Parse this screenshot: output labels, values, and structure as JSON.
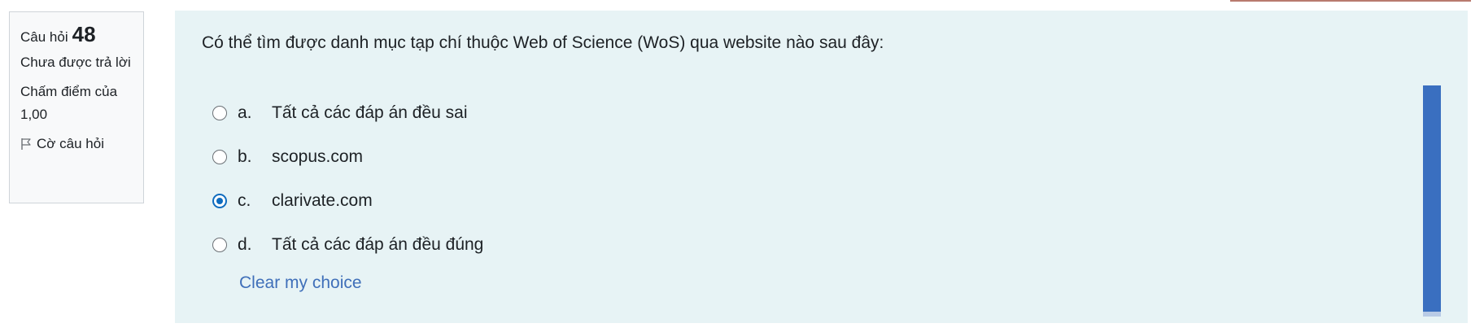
{
  "info": {
    "question_label": "Câu hỏi",
    "question_number": "48",
    "status": "Chưa được trả lời",
    "grade": "Chấm điểm của 1,00",
    "flag_label": "Cờ câu hỏi"
  },
  "question": {
    "text": "Có thể tìm được danh mục tạp chí thuộc Web of Science (WoS) qua website nào sau đây:",
    "answers": [
      {
        "letter": "a.",
        "text": "Tất cả các đáp án đều sai",
        "selected": false
      },
      {
        "letter": "b.",
        "text": "scopus.com",
        "selected": false
      },
      {
        "letter": "c.",
        "text": "clarivate.com",
        "selected": true
      },
      {
        "letter": "d.",
        "text": "Tất cả các đáp án đều đúng",
        "selected": false
      }
    ],
    "clear_label": "Clear my choice"
  },
  "colors": {
    "panel_bg": "#e7f3f5",
    "link": "#3f6fb9",
    "radio_checked": "#0f6cbf",
    "scrollbar": "#3a6fc0"
  }
}
